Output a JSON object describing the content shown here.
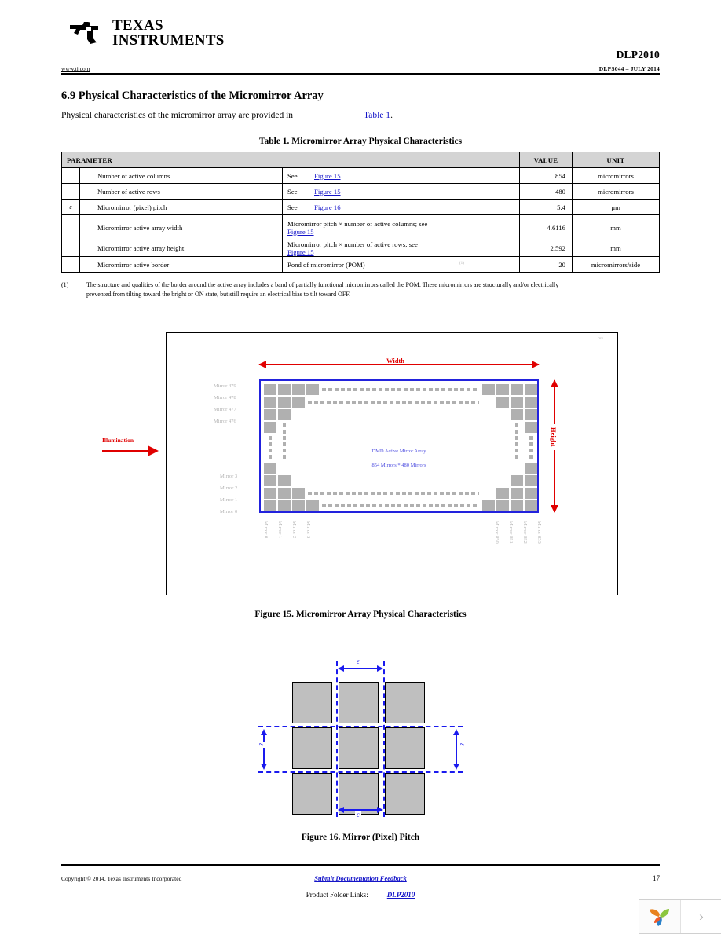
{
  "header": {
    "brand_line1": "TEXAS",
    "brand_line2": "INSTRUMENTS",
    "website": "www.ti.com",
    "part_number": "DLP2010",
    "doc_number": "DLPS044 – JULY 2014"
  },
  "section": {
    "number_title": "6.9 Physical Characteristics of the Micromirror Array",
    "intro_before": "Physical characteristics of the micromirror array are provided in",
    "intro_link": "Table 1",
    "intro_after": "."
  },
  "table": {
    "caption": "Table 1. Micromirror Array Physical Characteristics",
    "columns": [
      "PARAMETER",
      "VALUE",
      "UNIT"
    ],
    "rows": [
      {
        "symbol": "",
        "parameter": "Number of active columns",
        "desc_pre": "See",
        "desc_link": "Figure 15",
        "desc_post": "",
        "value": "854",
        "unit": "micromirrors"
      },
      {
        "symbol": "",
        "parameter": "Number of active rows",
        "desc_pre": "See",
        "desc_link": "Figure 15",
        "desc_post": "",
        "value": "480",
        "unit": "micromirrors"
      },
      {
        "symbol": "ε",
        "parameter": "Micromirror (pixel) pitch",
        "desc_pre": "See",
        "desc_link": "Figure 16",
        "desc_post": "",
        "value": "5.4",
        "unit": "µm"
      },
      {
        "symbol": "",
        "parameter": "Micromirror active array width",
        "desc_pre": "Micromirror pitch × number of active columns; see",
        "desc_link": "Figure 15",
        "desc_post": "",
        "wrap": true,
        "value": "4.6116",
        "unit": "mm"
      },
      {
        "symbol": "",
        "parameter": "Micromirror active array height",
        "desc_pre": "Micromirror pitch × number of active rows; see",
        "desc_link": "Figure 15",
        "desc_post": "",
        "value": "2.592",
        "unit": "mm"
      },
      {
        "symbol": "",
        "parameter": "Micromirror active border",
        "desc_pre": "Pond of micromirror (POM)",
        "desc_link": "",
        "desc_post": "(1)",
        "value": "20",
        "unit": "micromirrors/side"
      }
    ]
  },
  "footnote": {
    "marker": "(1)",
    "text": "The structure and qualities of the border around the active array includes a band of partially functional micromirrors called the POM. These micromirrors are structurally and/or electrically prevented from tilting toward the bright or ON state, but still require an electrical bias to tilt toward OFF."
  },
  "figure15": {
    "caption": "Figure 15. Micromirror Array Physical Characteristics",
    "width_label": "Width",
    "height_label": "Height",
    "illumination_label": "Illumination",
    "array_title": "DMD Active Mirror Array",
    "array_subtitle": "854 Mirrors * 480 Mirrors",
    "left_labels": [
      "Mirror 479",
      "Mirror 478",
      "Mirror 477",
      "Mirror 476"
    ],
    "left_labels_bottom": [
      "Mirror 3",
      "Mirror 2",
      "Mirror 1",
      "Mirror 0"
    ],
    "bottom_left_labels": [
      "Mirror 0",
      "Mirror 1",
      "Mirror 2",
      "Mirror 3"
    ],
    "bottom_right_labels": [
      "Mirror 850",
      "Mirror 851",
      "Mirror 852",
      "Mirror 853"
    ],
    "corner_tag": "wa _____"
  },
  "figure16": {
    "caption": "Figure 16. Mirror (Pixel) Pitch",
    "pitch_symbol": "ε"
  },
  "footer": {
    "copyright": "Copyright © 2014, Texas Instruments Incorporated",
    "feedback": "Submit Documentation Feedback",
    "page_number": "17",
    "product_folder_label": "Product Folder Links:",
    "product_folder_link": "DLP2010"
  },
  "viewer": {
    "next_icon": "›"
  },
  "colors": {
    "link": "#1414c8",
    "red": "#e00000",
    "blue": "#2222dd",
    "mirror_gray": "#b0b0b0",
    "header_gray": "#d4d4d4"
  }
}
